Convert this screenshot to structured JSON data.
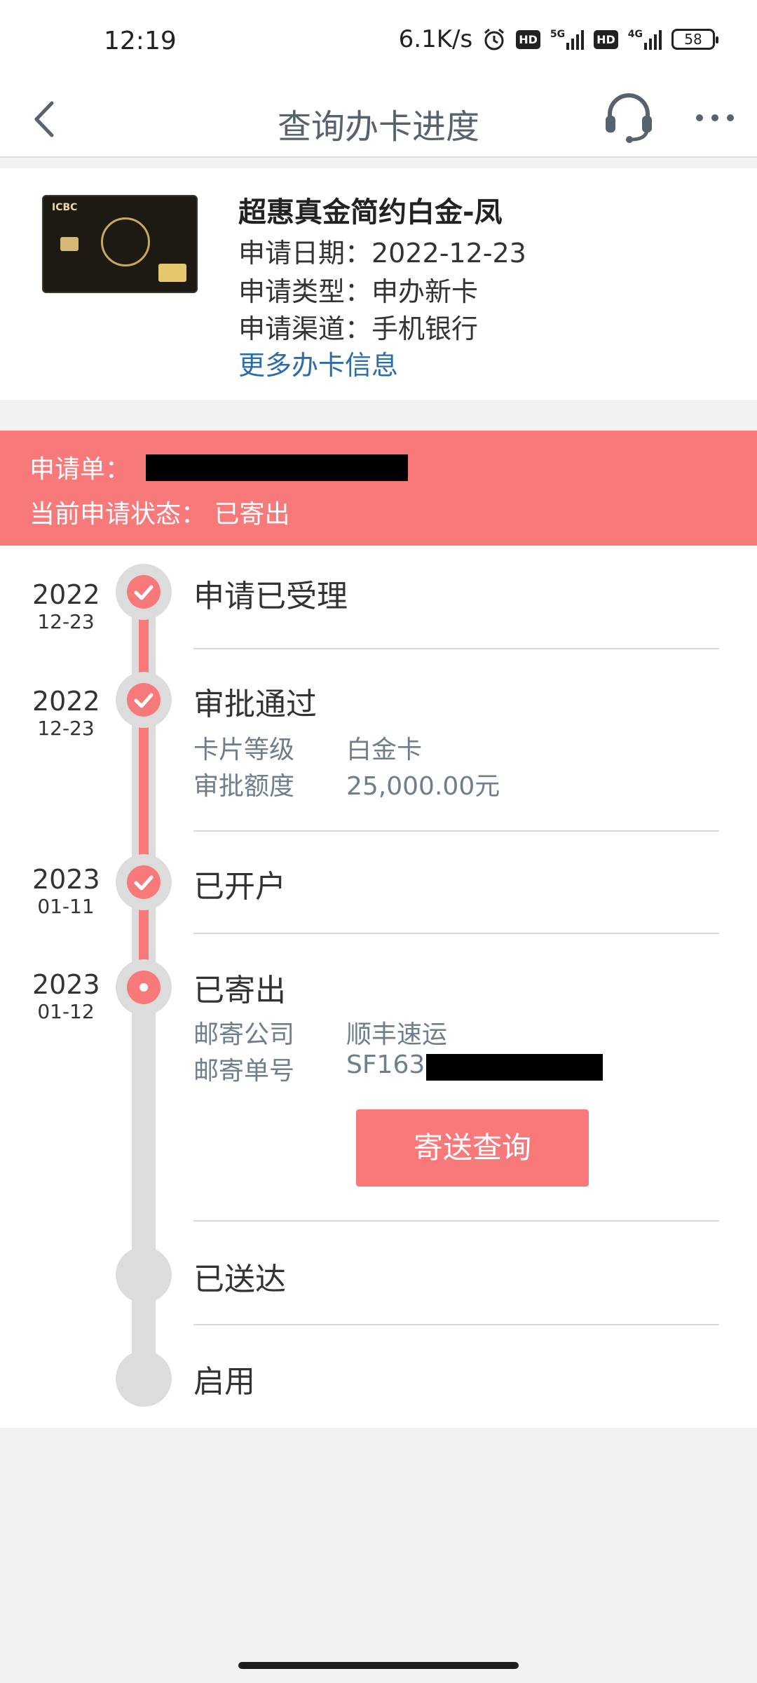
{
  "status_bar": {
    "time": "12:19",
    "net_speed": "6.1K/s",
    "hd1": "HD",
    "sig1": "5G",
    "hd2": "HD",
    "sig2": "4G",
    "battery": "58"
  },
  "nav": {
    "title": "查询办卡进度",
    "back_icon": "chevron-left-icon",
    "support_icon": "headset-icon",
    "more_icon": "more-horizontal-icon"
  },
  "card": {
    "name": "超惠真金简约白金-凤",
    "date_line": "申请日期：2022-12-23",
    "type_line": "申请类型：申办新卡",
    "channel_line": "申请渠道：手机银行",
    "more_link": "更多办卡信息",
    "card_brand": "ICBC"
  },
  "application": {
    "number_label": "申请单：",
    "status_line": "当前申请状态：  已寄出"
  },
  "timeline": [
    {
      "year": "2022",
      "md": "12-23",
      "title": "申请已受理",
      "state": "done"
    },
    {
      "year": "2022",
      "md": "12-23",
      "title": "审批通过",
      "state": "done",
      "details": [
        {
          "label": "卡片等级",
          "value": "白金卡"
        },
        {
          "label": "审批额度",
          "value": "25,000.00元"
        }
      ]
    },
    {
      "year": "2023",
      "md": "01-11",
      "title": "已开户",
      "state": "done"
    },
    {
      "year": "2023",
      "md": "01-12",
      "title": "已寄出",
      "state": "current",
      "details": [
        {
          "label": "邮寄公司",
          "value": "顺丰速运"
        },
        {
          "label": "邮寄单号",
          "value": "SF163"
        }
      ],
      "button": "寄送查询"
    },
    {
      "title": "已送达",
      "state": "pending"
    },
    {
      "title": "启用",
      "state": "pending"
    }
  ],
  "colors": {
    "accent": "#f8797a",
    "link": "#2b6cad",
    "muted": "#6f7e8c",
    "track": "#dcdcdc"
  }
}
